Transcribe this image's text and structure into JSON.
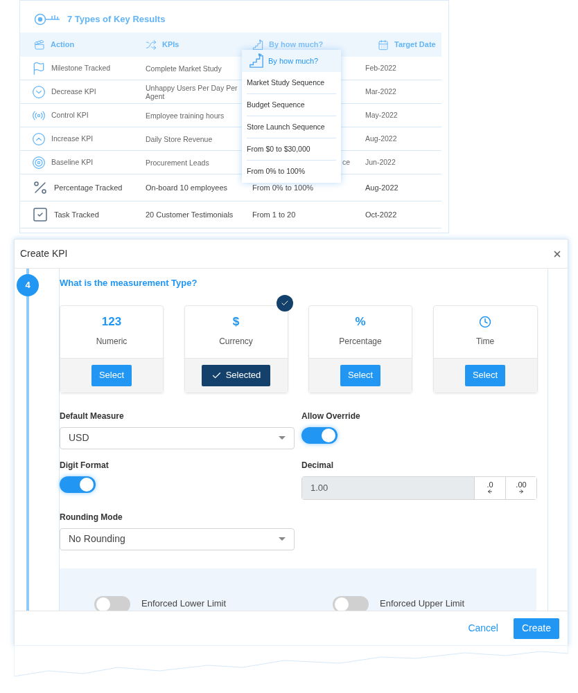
{
  "key_results": {
    "title": "7 Types of Key Results",
    "columns": [
      {
        "label": "Action"
      },
      {
        "label": "KPIs"
      },
      {
        "label": "By how much?"
      },
      {
        "label": "Target Date"
      }
    ],
    "rows": [
      {
        "type": "Milestone Tracked",
        "kpi": "Complete Market Study",
        "date": "Feb-2022",
        "emphasis": false
      },
      {
        "type": "Decrease KPI",
        "kpi": "Unhappy Users Per Day Per Agent",
        "date": "Mar-2022",
        "emphasis": false
      },
      {
        "type": "Control KPI",
        "kpi": "Employee training hours",
        "date": "May-2022",
        "emphasis": false
      },
      {
        "type": "Increase KPI",
        "kpi": "Daily Store Revenue",
        "date": "Aug-2022",
        "emphasis": false
      },
      {
        "type": "Baseline KPI",
        "kpi": "Procurement Leads",
        "amount": "ce",
        "date": "Jun-2022",
        "emphasis": false
      },
      {
        "type": "Percentage Tracked",
        "kpi": "On-board 10 employees",
        "amount": "From 0% to 100%",
        "date": "Aug-2022",
        "emphasis": true
      },
      {
        "type": "Task Tracked",
        "kpi": "20 Customer Testimonials",
        "amount": "From 1 to 20",
        "date": "Oct-2022",
        "emphasis": true
      }
    ]
  },
  "popup": {
    "title": "By how much?",
    "items": [
      "Market Study Sequence",
      "Budget Sequence",
      "Store Launch Sequence",
      "From $0 to $30,000",
      "From 0% to 100%"
    ]
  },
  "modal": {
    "title": "Create KPI",
    "step": "4",
    "question": "What is the measurement Type?",
    "measurement_types": [
      {
        "symbol": "123",
        "label": "Numeric",
        "button": "Select",
        "selected": false
      },
      {
        "symbol": "$",
        "label": "Currency",
        "button": "Selected",
        "selected": true
      },
      {
        "symbol": "%",
        "label": "Percentage",
        "button": "Select",
        "selected": false
      },
      {
        "label": "Time",
        "button": "Select",
        "selected": false
      }
    ],
    "default_measure": {
      "label": "Default Measure",
      "value": "USD"
    },
    "allow_override": {
      "label": "Allow Override",
      "on": true
    },
    "digit_format": {
      "label": "Digit Format",
      "on": true
    },
    "decimal": {
      "label": "Decimal",
      "value": "1.00",
      "buttons": [
        ".0",
        ".00"
      ]
    },
    "rounding_mode": {
      "label": "Rounding Mode",
      "value": "No Rounding"
    },
    "limits": [
      {
        "label": "Enforced Lower Limit",
        "on": false
      },
      {
        "label": "Enforced Upper Limit",
        "on": false
      }
    ],
    "cancel": "Cancel",
    "create": "Create"
  }
}
